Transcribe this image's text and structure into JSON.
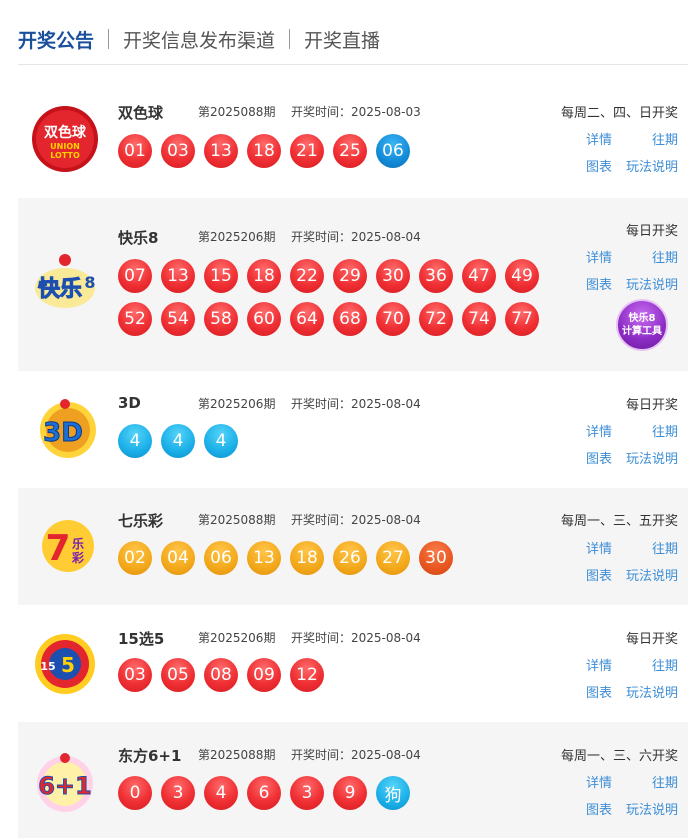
{
  "tabs": [
    {
      "label": "开奖公告",
      "active": true
    },
    {
      "label": "开奖信息发布渠道",
      "active": false
    },
    {
      "label": "开奖直播",
      "active": false
    }
  ],
  "colors": {
    "active_tab": "#1a4f9c",
    "link": "#3d8ed6",
    "red_ball": "#ef2f33",
    "blue_ball": "#138ad7",
    "orange_ball": "#f3a81a",
    "row_alt_bg": "#f5f5f5"
  },
  "lotteries": [
    {
      "name": "双色球",
      "issue": "第2025088期",
      "draw_time": "开奖时间：2025-08-03",
      "draw_days": "每周二、四、日开奖",
      "logo_icon": "ssq-logo",
      "logo_text": "双色球 UNION LOTTO",
      "balls": [
        "01",
        "03",
        "13",
        "18",
        "21",
        "25",
        "06"
      ],
      "links": {
        "detail": "详情",
        "history": "往期",
        "chart": "图表",
        "rules": "玩法说明"
      }
    },
    {
      "name": "快乐8",
      "issue": "第2025206期",
      "draw_time": "开奖时间：2025-08-04",
      "draw_days": "每日开奖",
      "logo_icon": "kl8-logo",
      "logo_text": "快乐8",
      "balls": [
        "07",
        "13",
        "15",
        "18",
        "22",
        "29",
        "30",
        "36",
        "47",
        "49",
        "52",
        "54",
        "58",
        "60",
        "64",
        "68",
        "70",
        "72",
        "74",
        "77"
      ],
      "links": {
        "detail": "详情",
        "history": "往期",
        "chart": "图表",
        "rules": "玩法说明"
      },
      "calc_tool": {
        "line1": "快乐8",
        "line2": "计算工具"
      }
    },
    {
      "name": "3D",
      "issue": "第2025206期",
      "draw_time": "开奖时间：2025-08-04",
      "draw_days": "每日开奖",
      "logo_icon": "3d-logo",
      "logo_text": "3D",
      "balls": [
        "4",
        "4",
        "4"
      ],
      "links": {
        "detail": "详情",
        "history": "往期",
        "chart": "图表",
        "rules": "玩法说明"
      }
    },
    {
      "name": "七乐彩",
      "issue": "第2025088期",
      "draw_time": "开奖时间：2025-08-04",
      "draw_days": "每周一、三、五开奖",
      "logo_icon": "qlc-logo",
      "logo_text": "7乐彩",
      "balls": [
        "02",
        "04",
        "06",
        "13",
        "18",
        "26",
        "27",
        "30"
      ],
      "links": {
        "detail": "详情",
        "history": "往期",
        "chart": "图表",
        "rules": "玩法说明"
      }
    },
    {
      "name": "15选5",
      "issue": "第2025206期",
      "draw_time": "开奖时间：2025-08-04",
      "draw_days": "每日开奖",
      "logo_icon": "15x5-logo",
      "logo_text": "15选5",
      "balls": [
        "03",
        "05",
        "08",
        "09",
        "12"
      ],
      "links": {
        "detail": "详情",
        "history": "往期",
        "chart": "图表",
        "rules": "玩法说明"
      }
    },
    {
      "name": "东方6+1",
      "issue": "第2025088期",
      "draw_time": "开奖时间：2025-08-04",
      "draw_days": "每周一、三、六开奖",
      "logo_icon": "df61-logo",
      "logo_text": "6+1",
      "balls": [
        "0",
        "3",
        "4",
        "6",
        "3",
        "9",
        "狗"
      ],
      "links": {
        "detail": "详情",
        "history": "往期",
        "chart": "图表",
        "rules": "玩法说明"
      }
    }
  ]
}
